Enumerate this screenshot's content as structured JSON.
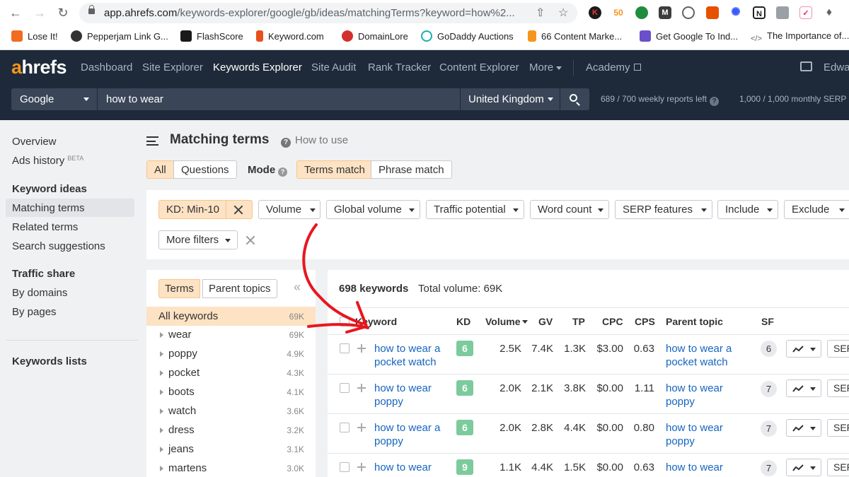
{
  "browser": {
    "url_host": "app.ahrefs.com",
    "url_path": "/keywords-explorer/google/gb/ideas/matchingTerms?keyword=how%2...",
    "bookmarks": [
      {
        "label": "Lose It!",
        "color": "#f26b22"
      },
      {
        "label": "Pepperjam Link G...",
        "color": "#333333"
      },
      {
        "label": "FlashScore",
        "color": "#1a1a1a"
      },
      {
        "label": "Keyword.com",
        "color": "#e8501e"
      },
      {
        "label": "DomainLore",
        "color": "#d32f2f"
      },
      {
        "label": "GoDaddy Auctions",
        "color": "#1bb0a7"
      },
      {
        "label": "66 Content Marke...",
        "color": "#f7941d"
      },
      {
        "label": "Get Google To Ind...",
        "color": "#6a4fc9"
      },
      {
        "label": "The Importance of..."
      }
    ]
  },
  "app": {
    "logo_a": "a",
    "logo_rest": "hrefs",
    "nav": [
      {
        "label": "Dashboard"
      },
      {
        "label": "Site Explorer"
      },
      {
        "label": "Keywords Explorer",
        "active": true
      },
      {
        "label": "Site Audit"
      },
      {
        "label": "Rank Tracker"
      },
      {
        "label": "Content Explorer"
      },
      {
        "label": "More"
      }
    ],
    "academy": "Academy",
    "user": "Edwa",
    "search_engine": "Google",
    "keyword": "how to wear",
    "country": "United Kingdom",
    "weekly_quota": "689 / 700 weekly reports left",
    "monthly_quota": "1,000 / 1,000 monthly SERP"
  },
  "sidebar": {
    "overview": "Overview",
    "ads_history": "Ads history",
    "beta": "BETA",
    "keyword_ideas_head": "Keyword ideas",
    "matching_terms": "Matching terms",
    "related_terms": "Related terms",
    "search_suggestions": "Search suggestions",
    "traffic_share_head": "Traffic share",
    "by_domains": "By domains",
    "by_pages": "By pages",
    "keywords_lists": "Keywords lists"
  },
  "page": {
    "title": "Matching terms",
    "how_to_use": "How to use",
    "all": "All",
    "questions": "Questions",
    "mode": "Mode",
    "terms_match": "Terms match",
    "phrase_match": "Phrase match"
  },
  "filters": {
    "kd": "KD: Min-10",
    "volume": "Volume",
    "global_volume": "Global volume",
    "traffic_potential": "Traffic potential",
    "word_count": "Word count",
    "serp_features": "SERP features",
    "include": "Include",
    "exclude": "Exclude",
    "more_filters": "More filters"
  },
  "terms_panel": {
    "terms_tab": "Terms",
    "parent_topics_tab": "Parent topics",
    "collapse": "«",
    "all_keywords": "All keywords",
    "all_count": "69K",
    "items": [
      {
        "term": "wear",
        "count": "69K"
      },
      {
        "term": "poppy",
        "count": "4.9K"
      },
      {
        "term": "pocket",
        "count": "4.3K"
      },
      {
        "term": "boots",
        "count": "4.1K"
      },
      {
        "term": "watch",
        "count": "3.6K"
      },
      {
        "term": "dress",
        "count": "3.2K"
      },
      {
        "term": "jeans",
        "count": "3.1K"
      },
      {
        "term": "martens",
        "count": "3.0K"
      }
    ]
  },
  "results": {
    "count": "698 keywords",
    "total_volume": "Total volume: 69K",
    "columns": {
      "keyword": "Keyword",
      "kd": "KD",
      "volume": "Volume",
      "gv": "GV",
      "tp": "TP",
      "cpc": "CPC",
      "cps": "CPS",
      "parent_topic": "Parent topic",
      "sf": "SF"
    },
    "serp_btn": "SERP",
    "rows": [
      {
        "keyword": "how to wear a pocket watch",
        "kd": "6",
        "volume": "2.5K",
        "gv": "7.4K",
        "tp": "1.3K",
        "cpc": "$3.00",
        "cps": "0.63",
        "parent": "how to wear a pocket watch",
        "sf": "6"
      },
      {
        "keyword": "how to wear poppy",
        "kd": "6",
        "volume": "2.0K",
        "gv": "2.1K",
        "tp": "3.8K",
        "cpc": "$0.00",
        "cps": "1.11",
        "parent": "how to wear poppy",
        "sf": "7"
      },
      {
        "keyword": "how to wear a poppy",
        "kd": "6",
        "volume": "2.0K",
        "gv": "2.8K",
        "tp": "4.4K",
        "cpc": "$0.00",
        "cps": "0.80",
        "parent": "how to wear poppy",
        "sf": "7"
      },
      {
        "keyword": "how to wear",
        "kd": "9",
        "volume": "1.1K",
        "gv": "4.4K",
        "tp": "1.5K",
        "cpc": "$0.00",
        "cps": "0.63",
        "parent": "how to wear",
        "sf": "7"
      }
    ]
  },
  "colors": {
    "header_bg": "#1e2a39",
    "accent_orange": "#f7941d",
    "selected_bg": "#fde2c3",
    "kd_easy": "#7ccb9c",
    "link_blue": "#1565c0",
    "annotation_red": "#e8161f"
  }
}
